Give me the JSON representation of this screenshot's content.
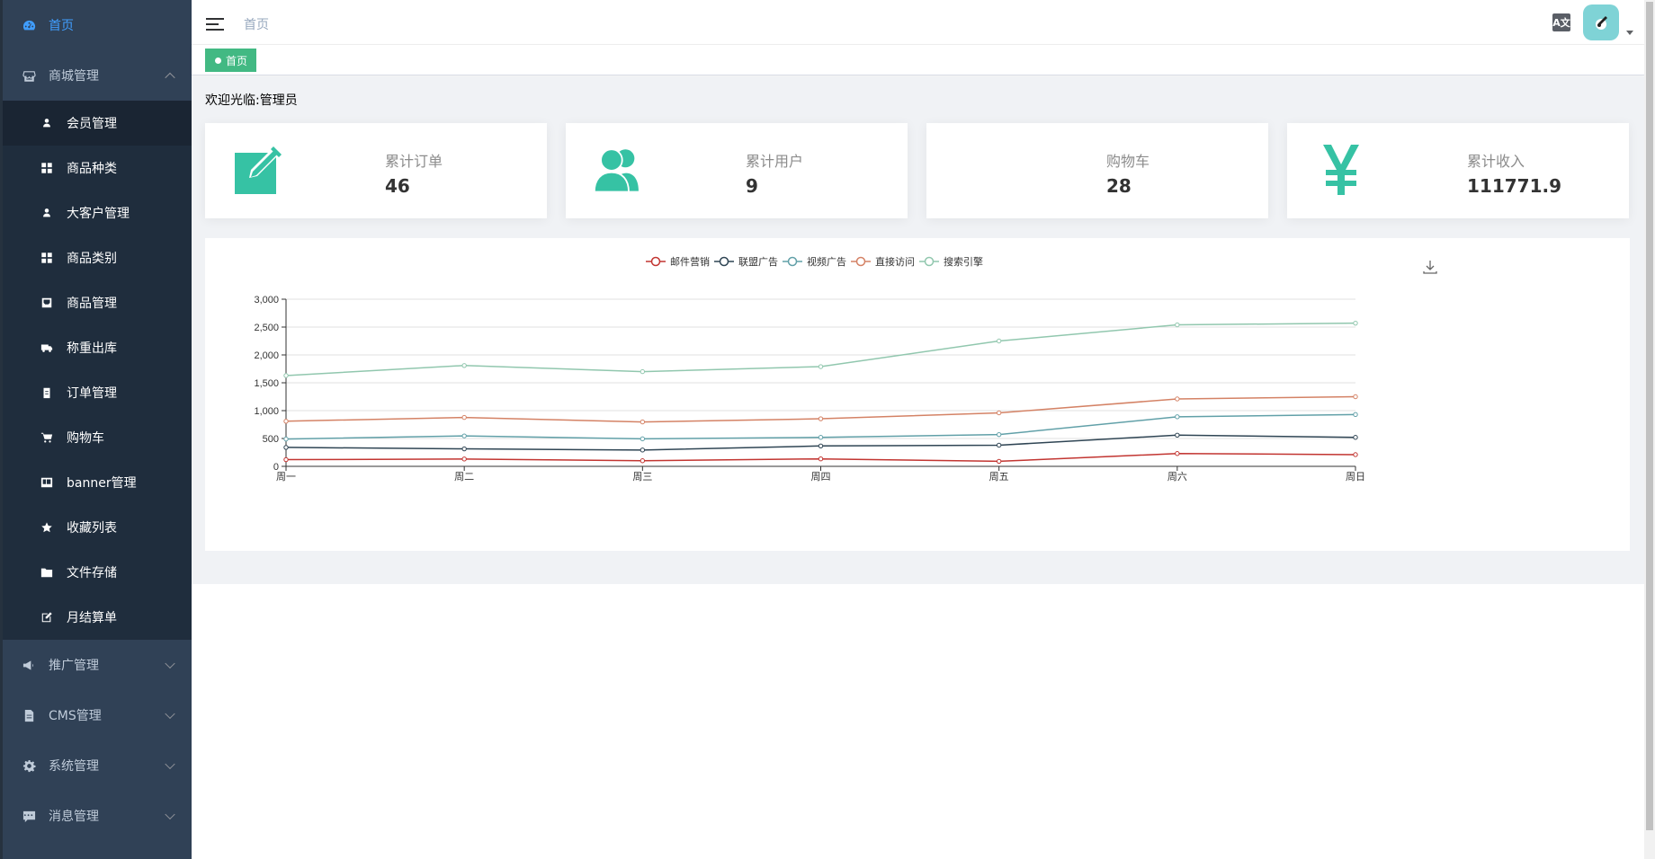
{
  "sidebar": {
    "home": "首页",
    "mall": {
      "label": "商城管理",
      "items": [
        {
          "label": "会员管理",
          "icon": "user-icon"
        },
        {
          "label": "商品种类",
          "icon": "grid-icon"
        },
        {
          "label": "大客户管理",
          "icon": "user-icon"
        },
        {
          "label": "商品类别",
          "icon": "grid-icon"
        },
        {
          "label": "商品管理",
          "icon": "inbox-icon"
        },
        {
          "label": "称重出库",
          "icon": "truck-icon"
        },
        {
          "label": "订单管理",
          "icon": "clipboard-icon"
        },
        {
          "label": "购物车",
          "icon": "cart-icon"
        },
        {
          "label": "banner管理",
          "icon": "ad-icon"
        },
        {
          "label": "收藏列表",
          "icon": "star-icon"
        },
        {
          "label": "文件存储",
          "icon": "folder-icon"
        },
        {
          "label": "月结算单",
          "icon": "edit-icon"
        }
      ]
    },
    "promotion": "推广管理",
    "cms": "CMS管理",
    "system": "系统管理",
    "message": "消息管理"
  },
  "navbar": {
    "breadcrumb": "首页",
    "translate_label": "A文"
  },
  "tags": {
    "home": "首页"
  },
  "welcome": "欢迎光临:管理员",
  "cards": [
    {
      "label": "累计订单",
      "value": "46",
      "icon": "edit-square-icon"
    },
    {
      "label": "累计用户",
      "value": "9",
      "icon": "users-icon"
    },
    {
      "label": "购物车",
      "value": "28",
      "icon": ""
    },
    {
      "label": "累计收入",
      "value": "111771.9",
      "icon": "yen-icon"
    }
  ],
  "colors": {
    "sidebar_bg": "#304156",
    "accent": "#409eff",
    "tag_green": "#42b983",
    "card_icon": "#36c2a4"
  },
  "chart_data": {
    "type": "line",
    "categories": [
      "周一",
      "周二",
      "周三",
      "周四",
      "周五",
      "周六",
      "周日"
    ],
    "series": [
      {
        "name": "邮件营销",
        "color": "#c23531",
        "values": [
          120,
          132,
          101,
          134,
          90,
          230,
          210
        ]
      },
      {
        "name": "联盟广告",
        "color": "#2f4554",
        "values": [
          340,
          314,
          293,
          366,
          380,
          560,
          520
        ]
      },
      {
        "name": "视频广告",
        "color": "#61a0a8",
        "values": [
          490,
          546,
          494,
          520,
          570,
          890,
          930
        ]
      },
      {
        "name": "直接访问",
        "color": "#d48265",
        "values": [
          810,
          878,
          797,
          854,
          960,
          1210,
          1250
        ]
      },
      {
        "name": "搜索引擎",
        "color": "#91c7ae",
        "values": [
          1630,
          1810,
          1700,
          1790,
          2250,
          2540,
          2570
        ]
      }
    ],
    "yticks": [
      "0",
      "500",
      "1,000",
      "1,500",
      "2,000",
      "2,500",
      "3,000"
    ],
    "ylim": [
      0,
      3000
    ],
    "grid": true,
    "legend": "top-center"
  }
}
